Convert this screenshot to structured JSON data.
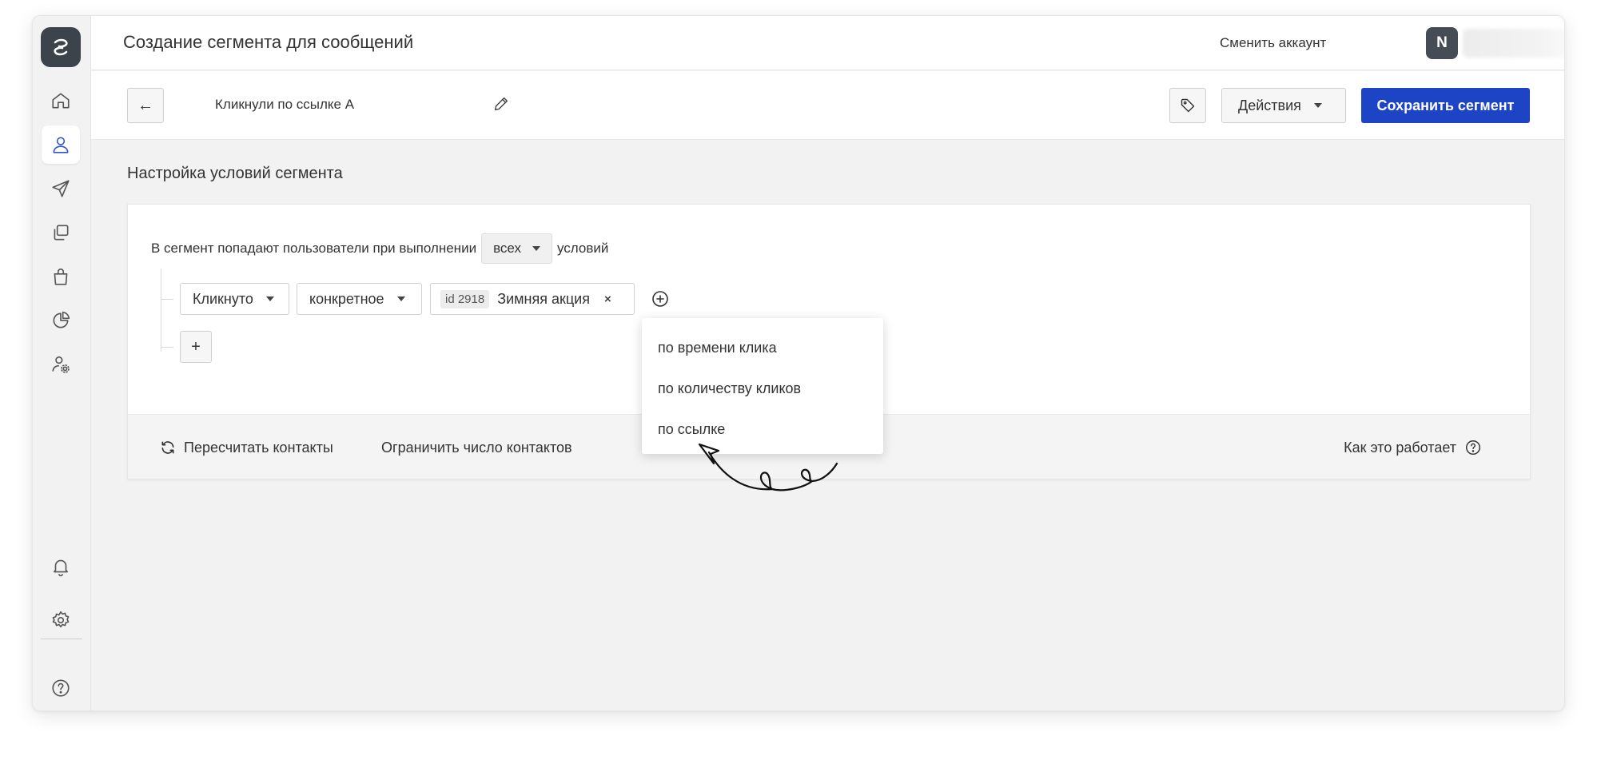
{
  "app": {
    "title": "Создание сегмента для сообщений",
    "switch_account": "Сменить аккаунт",
    "avatar_letter": "N"
  },
  "sidebar": {
    "items": [
      {
        "name": "home",
        "icon": "home-icon",
        "active": false
      },
      {
        "name": "contacts",
        "icon": "user-icon",
        "active": true
      },
      {
        "name": "campaigns",
        "icon": "send-icon",
        "active": false
      },
      {
        "name": "templates",
        "icon": "copy-icon",
        "active": false
      },
      {
        "name": "shop",
        "icon": "bag-icon",
        "active": false
      },
      {
        "name": "analytics",
        "icon": "pie-chart-icon",
        "active": false
      },
      {
        "name": "user-settings",
        "icon": "user-gear-icon",
        "active": false
      },
      {
        "name": "notifications",
        "icon": "bell-icon",
        "active": false
      },
      {
        "name": "settings",
        "icon": "gear-icon",
        "active": false
      },
      {
        "name": "help",
        "icon": "help-icon",
        "active": false
      }
    ]
  },
  "toolbar": {
    "back_symbol": "←",
    "segment_name": "Кликнули по ссылке А",
    "actions_label": "Действия",
    "save_label": "Сохранить сегмент"
  },
  "main": {
    "section_title": "Настройка условий сегмента",
    "condition_prefix": "В сегмент попадают пользователи при выполнении",
    "condition_mode": "всех",
    "condition_suffix": "условий",
    "rule": {
      "event": "Кликнуто",
      "type": "конкретное",
      "id_label": "id 2918",
      "campaign_name": "Зимняя акция",
      "remove_symbol": "×"
    },
    "add_symbol": "+",
    "footer": {
      "recalc_label": "Пересчитать контакты",
      "limit_label": "Ограничить число контактов",
      "how_label": "Как это работает"
    }
  },
  "dropdown": {
    "items": [
      "по времени клика",
      "по количеству кликов",
      "по ссылке"
    ]
  },
  "colors": {
    "primary": "#1e44c6",
    "sidebar_bg": "#f2f2f2",
    "logo_bg": "#3d434b",
    "active_icon": "#2f55d4"
  }
}
